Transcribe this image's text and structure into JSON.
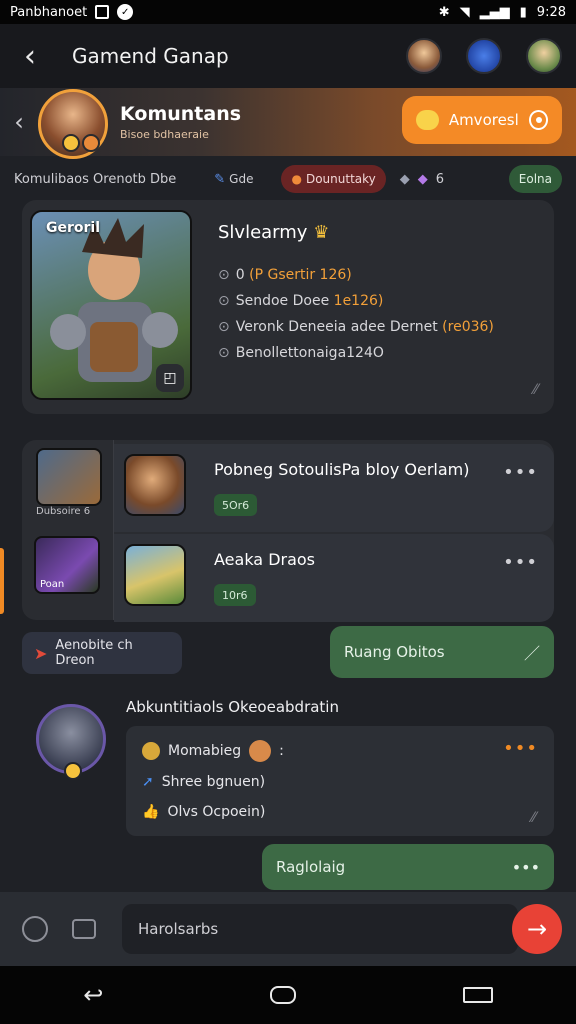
{
  "status": {
    "left_text": "Panbhanoet",
    "time": "9:28"
  },
  "topbar": {
    "title": "Gamend Ganap"
  },
  "community": {
    "name": "Komuntans",
    "subtitle": "Bisoe bdhaeraie",
    "action_label": "Amvoresl"
  },
  "filters": {
    "label": "Komulibaos Orenotb Dbe",
    "chip1": "Gde",
    "chip2": "Dounuttaky",
    "chip3": "6",
    "chip4": "Eolna"
  },
  "hero": {
    "image_label": "Geroril",
    "title": "Slvlearmy",
    "stats": [
      {
        "bullet": "⊙",
        "prefix": "0",
        "value": "(P Gsertir 126)"
      },
      {
        "bullet": "⊙",
        "prefix": "Sendoe Doee",
        "value": "1e126)"
      },
      {
        "bullet": "⊙",
        "prefix": "Veronk Deneeia adee Dernet",
        "value": "(re036)"
      },
      {
        "bullet": "⊙",
        "prefix": "Benollettonaig",
        "value": "a124O"
      }
    ]
  },
  "games": {
    "left_caption": "Dubsoire 6",
    "left_caption2": "Poan",
    "rows": [
      {
        "title": "Pobneg SotoulisPa bloy Oerlam)",
        "badge": "5Or6"
      },
      {
        "title": "Aeaka Draos",
        "badge": "10r6"
      }
    ]
  },
  "pills": {
    "left": "Aenobite ch Dreon",
    "right": "Ruang Obitos"
  },
  "post": {
    "header": "Abkuntitiaols Okeoeabdratin",
    "line1": "Momabieg",
    "line1_suffix": ":",
    "line2": "Shree bgnuen)",
    "line3": "Olvs Ocpoein)"
  },
  "reply": {
    "text": "Raglolaig"
  },
  "composer": {
    "placeholder": "Harolsarbs"
  },
  "colors": {
    "accent": "#f48a26",
    "send": "#e84236",
    "green": "#3d6a45"
  }
}
